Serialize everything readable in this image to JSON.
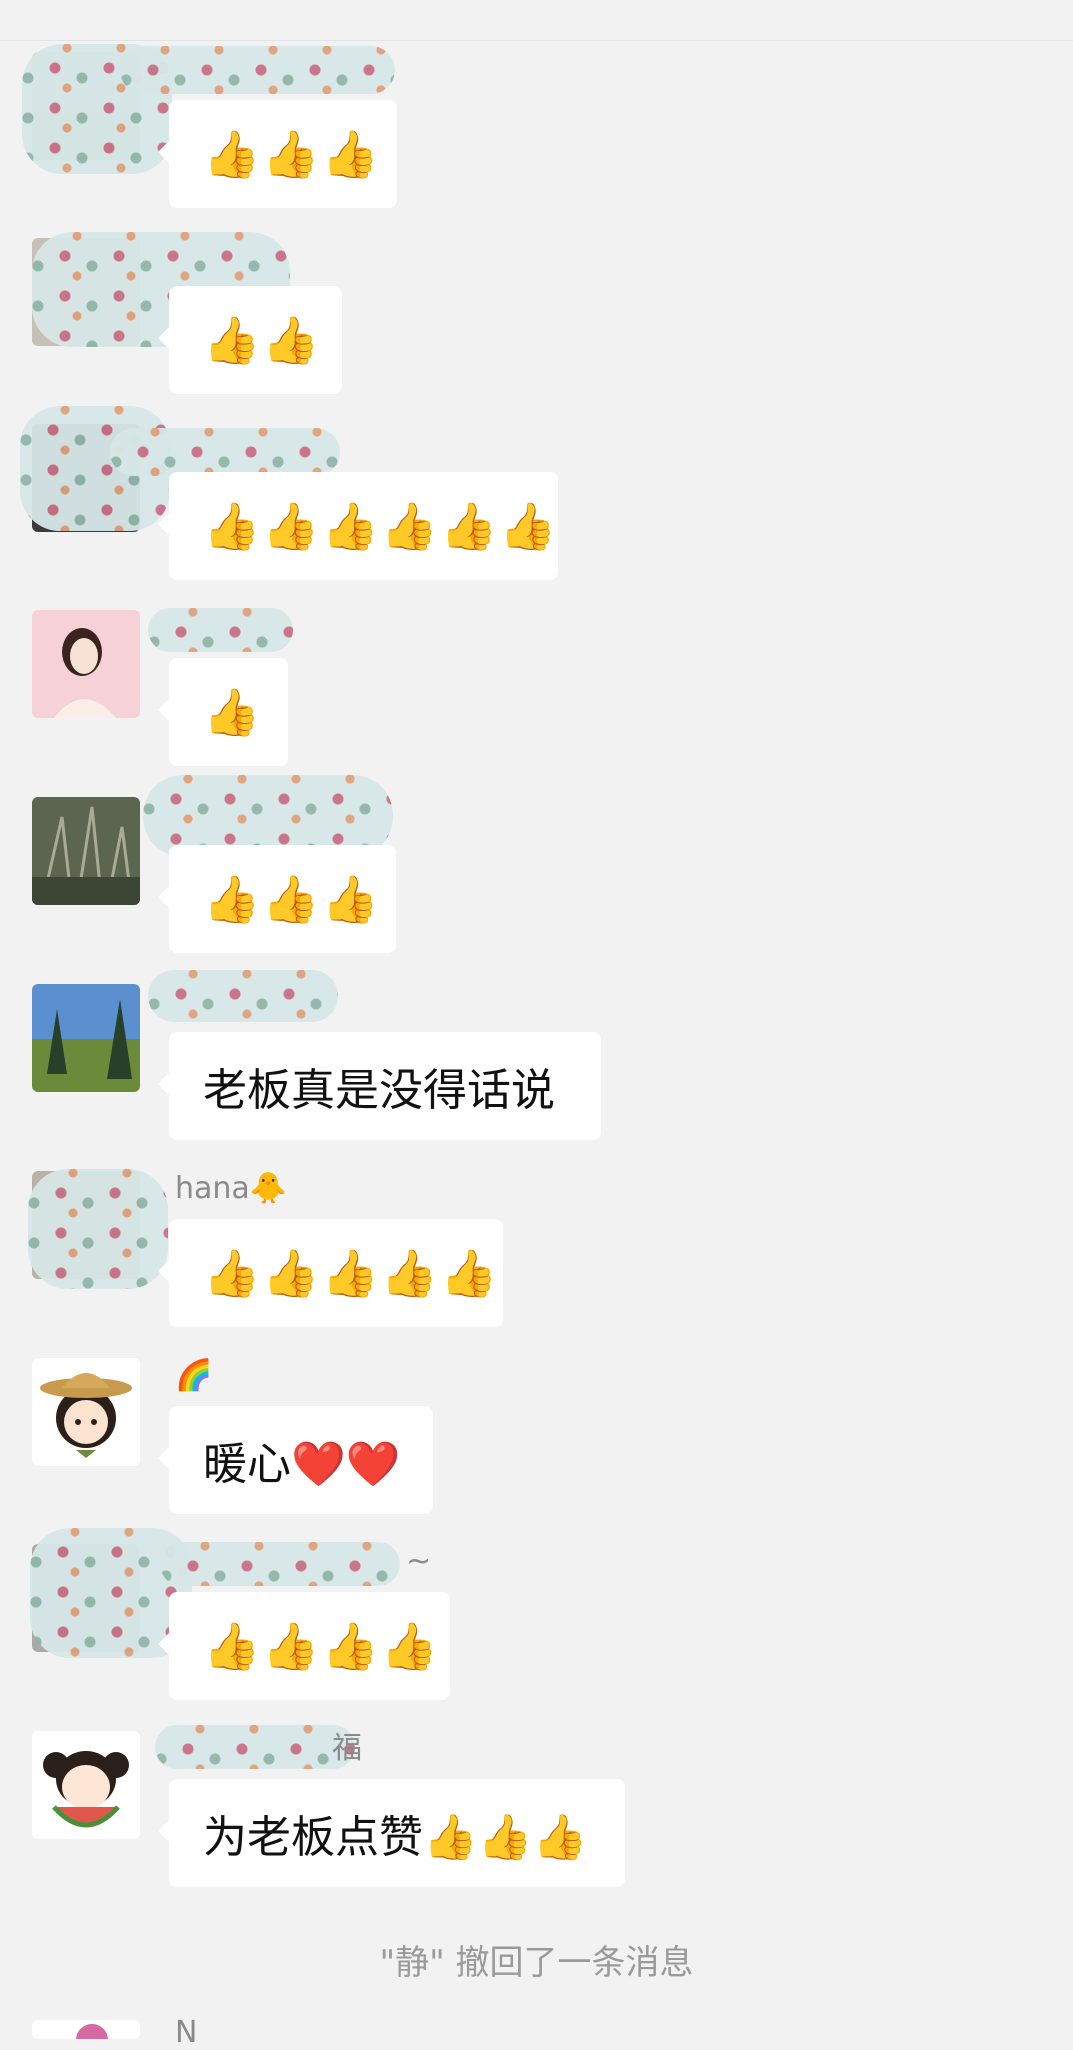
{
  "header": {
    "title": ""
  },
  "messages": [
    {
      "sender": "",
      "text": "👍👍👍",
      "avatar": "blurred-avatar"
    },
    {
      "sender": "",
      "text": "👍👍",
      "avatar": "blurred-avatar"
    },
    {
      "sender": "",
      "text": "👍👍👍👍👍👍",
      "avatar": "blurred-avatar"
    },
    {
      "sender": "",
      "text": "👍",
      "avatar": "girl-cartoon-avatar"
    },
    {
      "sender": "",
      "text": "👍👍👍",
      "avatar": "grass-photo-avatar"
    },
    {
      "sender": "",
      "text": "老板真是没得话说",
      "avatar": "landscape-photo-avatar"
    },
    {
      "sender": "hana🐥",
      "text": "👍👍👍👍👍",
      "avatar": "blurred-avatar"
    },
    {
      "sender": "🌈",
      "text": "暖心❤️❤️",
      "avatar": "girl-hat-avatar"
    },
    {
      "sender": "~",
      "text": "👍👍👍👍",
      "avatar": "blurred-avatar"
    },
    {
      "sender": "福",
      "text": "为老板点赞👍👍👍",
      "avatar": "girl-watermelon-avatar"
    }
  ],
  "system_notice": "\"静\" 撤回了一条消息",
  "next_sender_partial": "N"
}
